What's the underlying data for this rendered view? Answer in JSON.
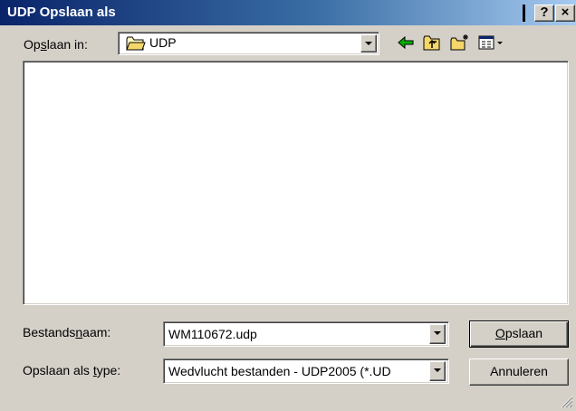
{
  "window": {
    "title": "UDP Opslaan als",
    "help_label": "?",
    "close_label": "×"
  },
  "lookin": {
    "label_pre": "Op",
    "label_accel": "s",
    "label_post": "laan in:",
    "value": "UDP",
    "icon": "folder-icon"
  },
  "toolbar": {
    "icons": [
      "back-arrow-icon",
      "up-folder-icon",
      "new-folder-icon",
      "view-menu-icon"
    ]
  },
  "filename": {
    "label_pre": "Bestands",
    "label_accel": "n",
    "label_post": "aam:",
    "value": "WM110672.udp"
  },
  "filetype": {
    "label_pre": "Opslaan als ",
    "label_accel": "t",
    "label_post": "ype:",
    "value": "Wedvlucht bestanden - UDP2005 (*.UD"
  },
  "buttons": {
    "save_accel": "O",
    "save_rest": "pslaan",
    "cancel": "Annuleren"
  },
  "colors": {
    "title_start": "#0a246a",
    "title_end": "#a6caf0",
    "face": "#d4d0c8"
  }
}
